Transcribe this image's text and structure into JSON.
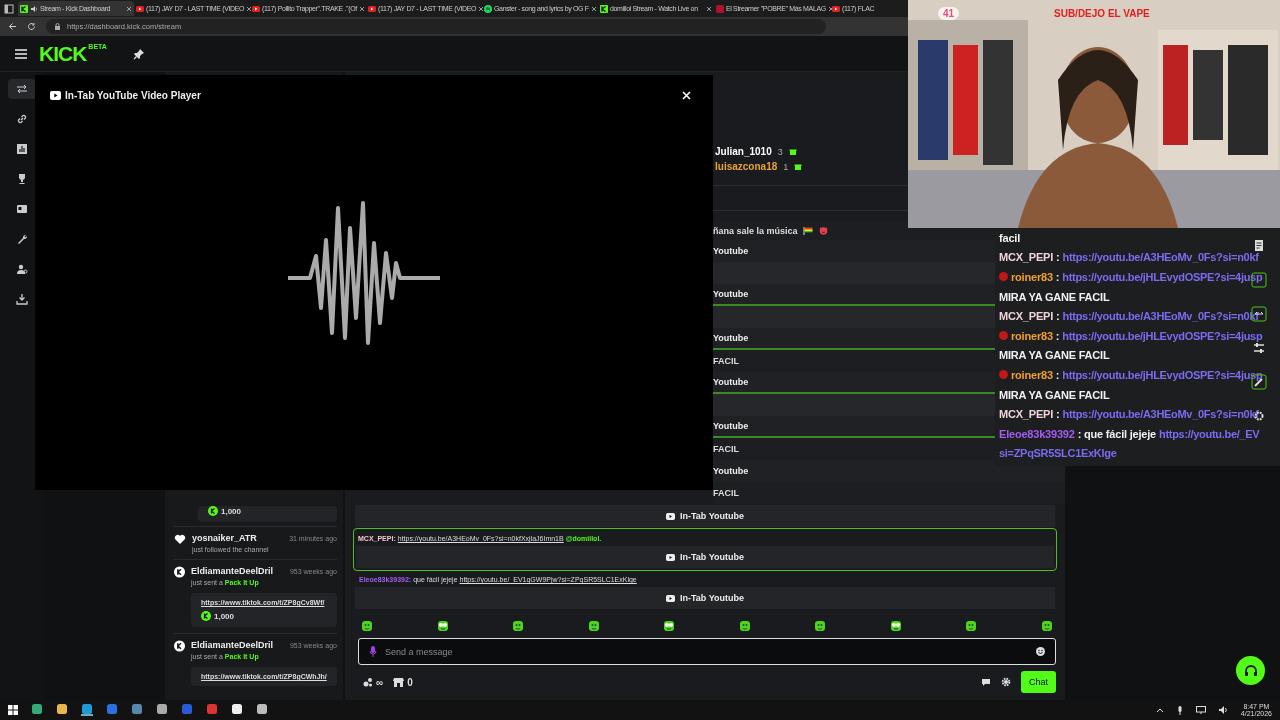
{
  "browser": {
    "tabs": [
      {
        "title": "Stream - Kick Dashboard",
        "kind": "kick",
        "selected": true,
        "audio": true
      },
      {
        "title": "(117) JAY D7 - LAST TIME (VIDEO",
        "kind": "youtube",
        "selected": false,
        "audio": false
      },
      {
        "title": "(117) Pollito Trapper\".TRAKE .\"(Of",
        "kind": "youtube",
        "selected": false,
        "audio": false
      },
      {
        "title": "(117) JAY D7 - LAST TIME (VIDEO",
        "kind": "youtube",
        "selected": false,
        "audio": false
      },
      {
        "title": "Ganster - song and lyrics by OG F",
        "kind": "spotify",
        "selected": false,
        "audio": false
      },
      {
        "title": "domiilol Stream - Watch Live on",
        "kind": "kick",
        "selected": false,
        "audio": false
      },
      {
        "title": "El Streamer \"POBRE\" Más MALAG",
        "kind": "news",
        "selected": false,
        "audio": false
      },
      {
        "title": "(117) FLAC",
        "kind": "youtube",
        "selected": false,
        "audio": false
      }
    ],
    "address": "https://dashboard.kick.com/stream"
  },
  "header": {
    "logo": "KICK",
    "logo_badge": "BETA"
  },
  "rail": {
    "items": [
      {
        "selected": true
      },
      {
        "selected": false
      },
      {
        "selected": false
      },
      {
        "selected": false
      },
      {
        "selected": false
      },
      {
        "selected": false
      },
      {
        "selected": false
      },
      {
        "selected": false
      }
    ]
  },
  "modal": {
    "title": "In-Tab YouTube Video Player"
  },
  "activity": [
    {
      "kind": "gift_tail",
      "amount": "1,000"
    },
    {
      "kind": "follow",
      "user": "yosnaiker_ATR",
      "time": "31 minutes ago",
      "action": "just followed the channel"
    },
    {
      "kind": "gift",
      "user": "EldiamanteDeelDril",
      "time": "953 weeks ago",
      "action": "just sent a **Pack It Up**",
      "link": "https://www.tiktok.com/t/ZP8gCv8Wf/",
      "amount": "1,000"
    },
    {
      "kind": "gift",
      "user": "EldiamanteDeelDril",
      "time": "953 weeks ago",
      "action": "just sent a **Pack It Up**",
      "link": "https://www.tiktok.com/t/ZP8gCWhJh/"
    }
  ],
  "chat": {
    "leaderboard": [
      {
        "name": "Julian_1010",
        "count": "3",
        "color": "#ffffff"
      },
      {
        "name": "luisazcona18",
        "count": "1",
        "color": "#e8a33a"
      }
    ],
    "rows": [
      {
        "kind": "message",
        "text": "ñana sale la música",
        "highlighted": false
      },
      {
        "kind": "youtube",
        "label": "Youtube",
        "highlighted": false
      },
      {
        "kind": "gap",
        "highlighted": false
      },
      {
        "kind": "youtube",
        "label": "Youtube",
        "highlighted": true
      },
      {
        "kind": "gap",
        "highlighted": false
      },
      {
        "kind": "youtube",
        "label": "Youtube",
        "highlighted": true
      },
      {
        "kind": "text",
        "text": "FACIL",
        "highlighted": false
      },
      {
        "kind": "youtube",
        "label": "Youtube",
        "highlighted": true
      },
      {
        "kind": "gap",
        "highlighted": false
      },
      {
        "kind": "youtube",
        "label": "Youtube",
        "highlighted": true
      },
      {
        "kind": "text",
        "text": "FACIL",
        "highlighted": false
      },
      {
        "kind": "youtube",
        "label": "Youtube",
        "highlighted": false
      },
      {
        "kind": "text",
        "text": "FACIL",
        "highlighted": false
      }
    ],
    "lower": [
      {
        "kind": "youtube",
        "label": "In-Tab Youtube",
        "highlighted": false
      },
      {
        "kind": "message",
        "user": "MCX_PEPI:",
        "color": "#f3c6d0",
        "link": "https://youtu.be/A3HEoMv_0Fs?si=n0kfXxjlaJ6Imn1B",
        "mention": "@domiilol.",
        "highlighted": true
      },
      {
        "kind": "youtube",
        "label": "In-Tab Youtube",
        "highlighted": true
      },
      {
        "kind": "message",
        "user": "Eleoe83k39392:",
        "color": "#a55cf0",
        "text": "que fácil jejeje",
        "link": "https://youtu.be/_EV1qGW9Pjw?si=ZPqSR5SLC1ExKlge",
        "highlighted": false
      },
      {
        "kind": "youtube",
        "label": "In-Tab Youtube",
        "highlighted": false
      }
    ],
    "input": {
      "placeholder": "Send a message"
    },
    "footer": {
      "infinity": "∞",
      "store_count": "0",
      "chat_button": "Chat"
    }
  },
  "webcam": {
    "kind": "picture",
    "viewer_count": "41",
    "banner": "SUB/DEJO EL VAPE"
  },
  "overlay_chat": [
    {
      "kind": "text",
      "text": "facil"
    },
    {
      "kind": "message",
      "user": "MCX_PEPI",
      "color": "#f1d3da",
      "badge": false,
      "text": ":",
      "link": "https://youtu.be/A3HEoMv_0Fs?si=n0kf"
    },
    {
      "kind": "message",
      "user": "roiner83",
      "color": "#f0a030",
      "badge": true,
      "text": ":",
      "link": "https://youtu.be/jHLEvydOSPE?si=4jusp"
    },
    {
      "kind": "text",
      "text": "MIRA YA GANE FACIL"
    },
    {
      "kind": "message",
      "user": "MCX_PEPI",
      "color": "#f1d3da",
      "badge": false,
      "text": ":",
      "link": "https://youtu.be/A3HEoMv_0Fs?si=n0kf"
    },
    {
      "kind": "message",
      "user": "roiner83",
      "color": "#f0a030",
      "badge": true,
      "text": ":",
      "link": "https://youtu.be/jHLEvydOSPE?si=4jusp"
    },
    {
      "kind": "text",
      "text": "MIRA YA GANE FACIL"
    },
    {
      "kind": "message",
      "user": "roiner83",
      "color": "#f0a030",
      "badge": true,
      "text": ":",
      "link": "https://youtu.be/jHLEvydOSPE?si=4jusp"
    },
    {
      "kind": "text",
      "text": "MIRA YA GANE FACIL"
    },
    {
      "kind": "message",
      "user": "MCX_PEPI",
      "color": "#f1d3da",
      "badge": false,
      "text": ":",
      "link": "https://youtu.be/A3HEoMv_0Fs?si=n0kf"
    },
    {
      "kind": "message",
      "user": "Eleoe83k39392",
      "color": "#a55cf0",
      "badge": false,
      "text": ": que fácil jejeje",
      "link": "https://youtu.be/_EV",
      "link_continued": "si=ZPqSR5SLC1ExKlge"
    }
  ],
  "taskbar": {
    "apps": [
      {
        "selected": false
      },
      {
        "selected": false
      },
      {
        "selected": true
      },
      {
        "selected": false
      },
      {
        "selected": false
      },
      {
        "selected": false
      },
      {
        "selected": false
      },
      {
        "selected": false
      },
      {
        "selected": false
      },
      {
        "selected": false
      }
    ],
    "time": "8:47 PM",
    "date": "4/21/2026"
  }
}
